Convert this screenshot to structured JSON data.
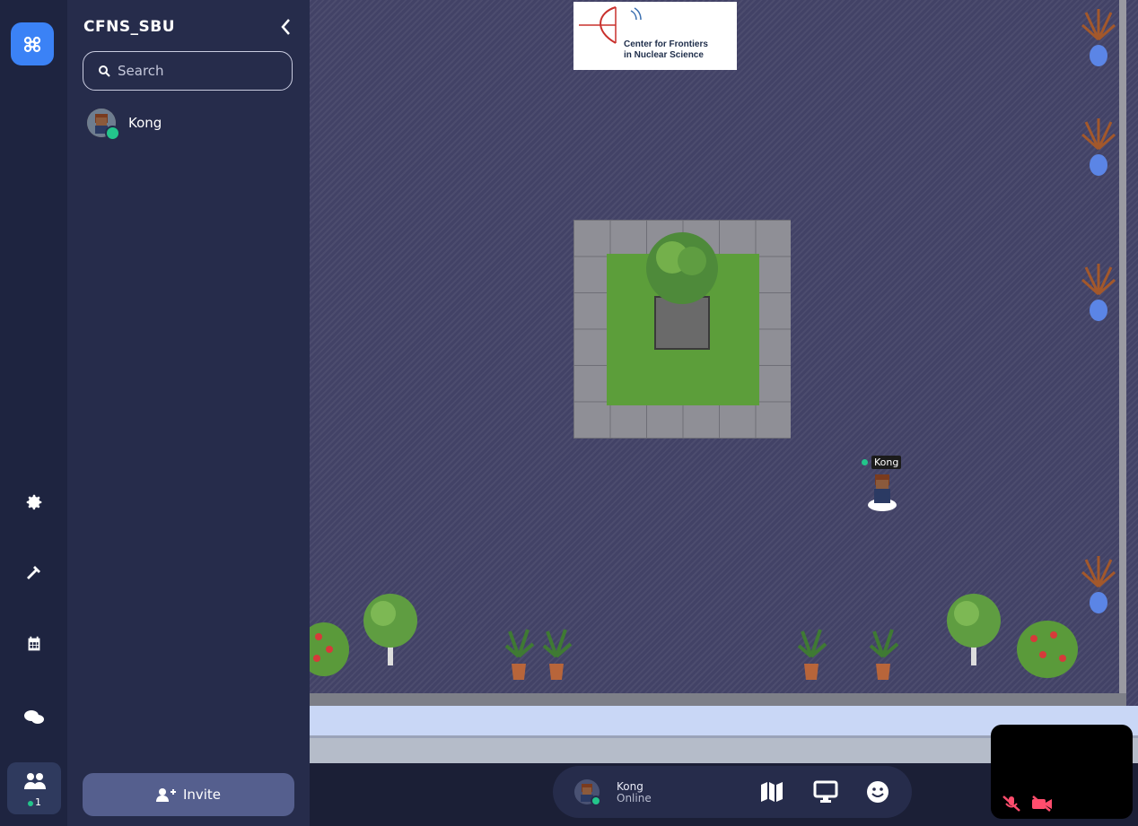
{
  "colors": {
    "accent": "#3b82f6",
    "online": "#23c58b",
    "panel_bg": "#262c4b",
    "rail_bg": "#1e2440",
    "muted_red": "#ff4d6d"
  },
  "sidebar": {
    "space_title": "CFNS_SBU",
    "search_placeholder": "Search",
    "members": [
      {
        "name": "Kong",
        "status": "online"
      }
    ],
    "invite_label": "Invite",
    "people_count": "1"
  },
  "rail": {
    "icons": [
      "logo-icon",
      "gear-icon",
      "hammer-icon",
      "calendar-icon",
      "chat-icon",
      "people-icon"
    ]
  },
  "map": {
    "banner_line1": "Center for Frontiers",
    "banner_line2": "in Nuclear Science",
    "player_tag": "Kong"
  },
  "bottom_bar": {
    "user_name": "Kong",
    "user_status": "Online"
  }
}
